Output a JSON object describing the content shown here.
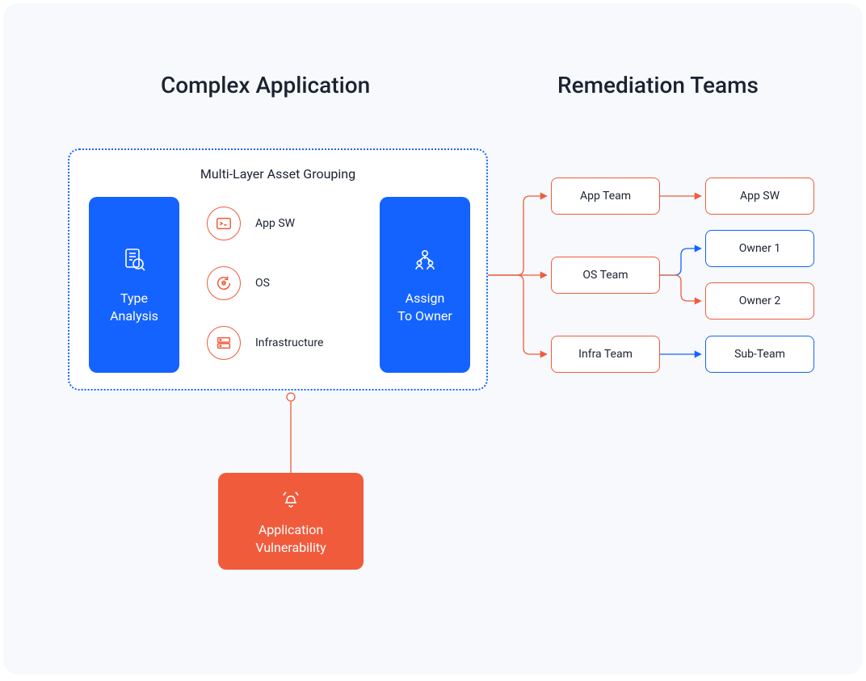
{
  "headings": {
    "left": "Complex Application",
    "right": "Remediation Teams"
  },
  "grouping": {
    "title": "Multi-Layer Asset Grouping",
    "type_analysis": "Type\nAnalysis",
    "assign_owner": "Assign\nTo Owner",
    "items": [
      "App SW",
      "OS",
      "Infrastructure"
    ]
  },
  "vulnerability": "Application\nVulnerability",
  "teams": {
    "app_team": "App Team",
    "os_team": "OS Team",
    "infra_team": "Infra Team"
  },
  "owners": {
    "app_sw": "App SW",
    "owner1": "Owner 1",
    "owner2": "Owner 2",
    "sub_team": "Sub-Team"
  },
  "colors": {
    "primary_blue": "#1463FF",
    "accent_red": "#F05B3C",
    "panel_bg": "#F7F9FC",
    "text": "#1b2230"
  }
}
